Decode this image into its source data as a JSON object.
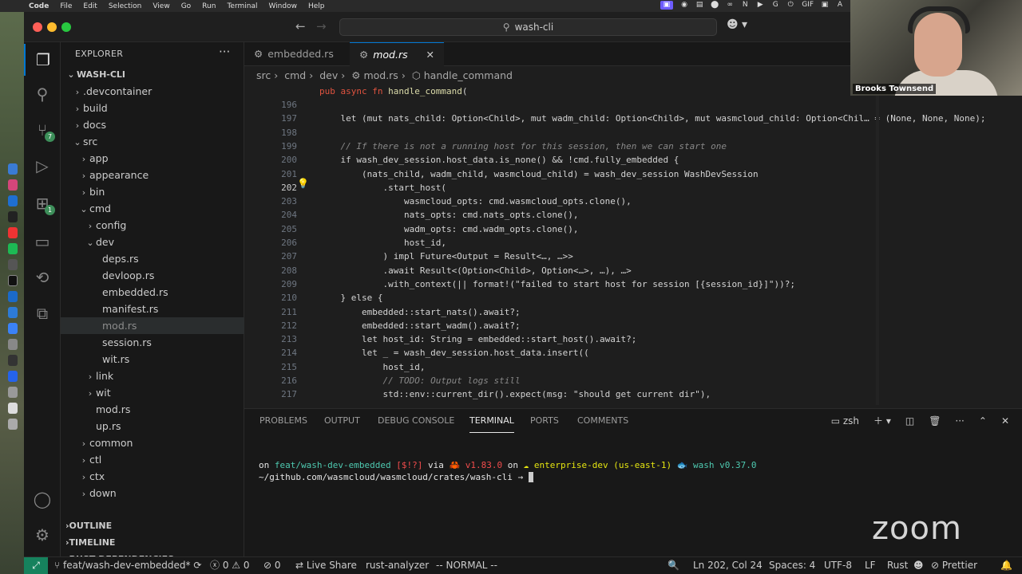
{
  "menubar": {
    "app": "Code",
    "items": [
      "File",
      "Edit",
      "Selection",
      "View",
      "Go",
      "Run",
      "Terminal",
      "Window",
      "Help"
    ],
    "tray": [
      "▣",
      "◉",
      "▤",
      "⬤",
      "∞",
      "N",
      "▶",
      "G",
      "⏻",
      "GIF",
      "▣",
      "A"
    ]
  },
  "window": {
    "search": "wash-cli"
  },
  "activity": {
    "scm_badge": "7",
    "ext_badge": "1"
  },
  "explorer": {
    "title": "EXPLORER",
    "root": "WASH-CLI",
    "items": [
      {
        "label": ".devcontainer",
        "depth": 1,
        "kind": "folder-closed"
      },
      {
        "label": "build",
        "depth": 1,
        "kind": "folder-closed"
      },
      {
        "label": "docs",
        "depth": 1,
        "kind": "folder-closed"
      },
      {
        "label": "src",
        "depth": 1,
        "kind": "folder-open"
      },
      {
        "label": "app",
        "depth": 2,
        "kind": "folder-closed"
      },
      {
        "label": "appearance",
        "depth": 2,
        "kind": "folder-closed"
      },
      {
        "label": "bin",
        "depth": 2,
        "kind": "folder-closed"
      },
      {
        "label": "cmd",
        "depth": 2,
        "kind": "folder-open"
      },
      {
        "label": "config",
        "depth": 3,
        "kind": "folder-closed"
      },
      {
        "label": "dev",
        "depth": 3,
        "kind": "folder-open"
      },
      {
        "label": "deps.rs",
        "depth": 4,
        "kind": "file"
      },
      {
        "label": "devloop.rs",
        "depth": 4,
        "kind": "file"
      },
      {
        "label": "embedded.rs",
        "depth": 4,
        "kind": "file"
      },
      {
        "label": "manifest.rs",
        "depth": 4,
        "kind": "file"
      },
      {
        "label": "mod.rs",
        "depth": 4,
        "kind": "file",
        "selected": true
      },
      {
        "label": "session.rs",
        "depth": 4,
        "kind": "file"
      },
      {
        "label": "wit.rs",
        "depth": 4,
        "kind": "file"
      },
      {
        "label": "link",
        "depth": 3,
        "kind": "folder-closed"
      },
      {
        "label": "wit",
        "depth": 3,
        "kind": "folder-closed"
      },
      {
        "label": "mod.rs",
        "depth": 3,
        "kind": "file"
      },
      {
        "label": "up.rs",
        "depth": 3,
        "kind": "file"
      },
      {
        "label": "common",
        "depth": 2,
        "kind": "folder-closed"
      },
      {
        "label": "ctl",
        "depth": 2,
        "kind": "folder-closed"
      },
      {
        "label": "ctx",
        "depth": 2,
        "kind": "folder-closed"
      },
      {
        "label": "down",
        "depth": 2,
        "kind": "folder-closed"
      }
    ],
    "sections": [
      "OUTLINE",
      "TIMELINE",
      "RUST DEPENDENCIES"
    ]
  },
  "tabs": [
    {
      "label": "embedded.rs"
    },
    {
      "label": "mod.rs",
      "active": true
    }
  ],
  "breadcrumb": [
    "src",
    "cmd",
    "dev",
    "mod.rs",
    "handle_command"
  ],
  "sticky": "pub async fn handle_command(",
  "code": [
    {
      "n": "196",
      "t": ""
    },
    {
      "n": "197",
      "t": "    let (mut nats_child: Option<Child>, mut wadm_child: Option<Child>, mut wasmcloud_child: Option<Chil… = (None, None, None);"
    },
    {
      "n": "198",
      "t": ""
    },
    {
      "n": "199",
      "t": "    // If there is not a running host for this session, then we can start one"
    },
    {
      "n": "200",
      "t": "    if wash_dev_session.host_data.is_none() && !cmd.fully_embedded {"
    },
    {
      "n": "201",
      "t": "        (nats_child, wadm_child, wasmcloud_child) = wash_dev_session WashDevSession"
    },
    {
      "n": "202",
      "t": "            .start_host("
    },
    {
      "n": "203",
      "t": "                wasmcloud_opts: cmd.wasmcloud_opts.clone(),"
    },
    {
      "n": "204",
      "t": "                nats_opts: cmd.nats_opts.clone(),"
    },
    {
      "n": "205",
      "t": "                wadm_opts: cmd.wadm_opts.clone(),"
    },
    {
      "n": "206",
      "t": "                host_id,"
    },
    {
      "n": "207",
      "t": "            ) impl Future<Output = Result<…, …>>"
    },
    {
      "n": "208",
      "t": "            .await Result<(Option<Child>, Option<…>, …), …>"
    },
    {
      "n": "209",
      "t": "            .with_context(|| format!(\"failed to start host for session [{session_id}]\"))?;"
    },
    {
      "n": "210",
      "t": "    } else {"
    },
    {
      "n": "211",
      "t": "        embedded::start_nats().await?;"
    },
    {
      "n": "212",
      "t": "        embedded::start_wadm().await?;"
    },
    {
      "n": "213",
      "t": "        let host_id: String = embedded::start_host().await?;"
    },
    {
      "n": "214",
      "t": "        let _ = wash_dev_session.host_data.insert(("
    },
    {
      "n": "215",
      "t": "            host_id,"
    },
    {
      "n": "216",
      "t": "            // TODO: Output logs still"
    },
    {
      "n": "217",
      "t": "            std::env::current_dir().expect(msg: \"should get current dir\"),"
    }
  ],
  "panel": {
    "tabs": [
      "PROBLEMS",
      "OUTPUT",
      "DEBUG CONSOLE",
      "TERMINAL",
      "PORTS",
      "COMMENTS"
    ],
    "active": "TERMINAL",
    "shell": "zsh",
    "line1": {
      "on": "on",
      "branch": "feat/wash-dev-embedded",
      "flags": "[$!?]",
      "via": "via",
      "rust": "v1.83.0",
      "on2": "on",
      "ctx": "enterprise-dev (us-east-1)",
      "wash": "wash v0.37.0"
    },
    "line2": "~/github.com/wasmcloud/wasmcloud/crates/wash-cli → "
  },
  "status": {
    "branch": "feat/wash-dev-embedded*",
    "errors": "0",
    "warnings": "0",
    "ports": "0",
    "liveshare": "Live Share",
    "analyzer": "rust-analyzer",
    "mode": "-- NORMAL --",
    "pos": "Ln 202, Col 24",
    "spaces": "Spaces: 4",
    "enc": "UTF-8",
    "eol": "LF",
    "lang": "Rust",
    "prettier": "Prettier"
  },
  "webcam": {
    "name": "Brooks Townsend"
  },
  "watermark": "zoom"
}
